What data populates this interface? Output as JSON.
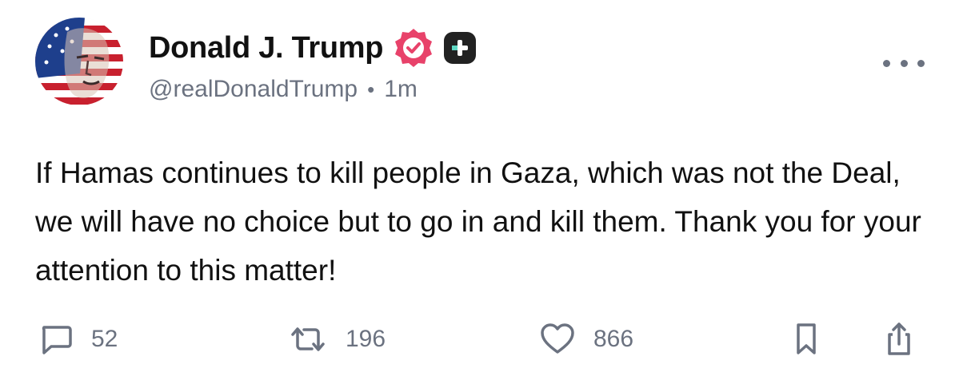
{
  "author": {
    "display_name": "Donald J. Trump",
    "handle": "@realDonaldTrump",
    "separator": "•",
    "timestamp": "1m",
    "verified_badge_color": "#e8426a",
    "plus_badge_color": "#222222"
  },
  "post": {
    "text": "If Hamas continues to kill people in Gaza, which was not the Deal, we will have no choice but to go in and kill them. Thank you for your attention to this matter!"
  },
  "actions": {
    "reply": {
      "icon": "reply-bubble-icon",
      "count": "52"
    },
    "retruth": {
      "icon": "retruth-arrows-icon",
      "count": "196"
    },
    "like": {
      "icon": "heart-icon",
      "count": "866"
    },
    "bookmark": {
      "icon": "bookmark-icon"
    },
    "share": {
      "icon": "share-icon"
    }
  },
  "menu": {
    "icon": "more-options-icon"
  },
  "colors": {
    "text": "#111111",
    "secondary_text": "#6b7280",
    "icon": "#6b7280",
    "background": "#ffffff"
  }
}
